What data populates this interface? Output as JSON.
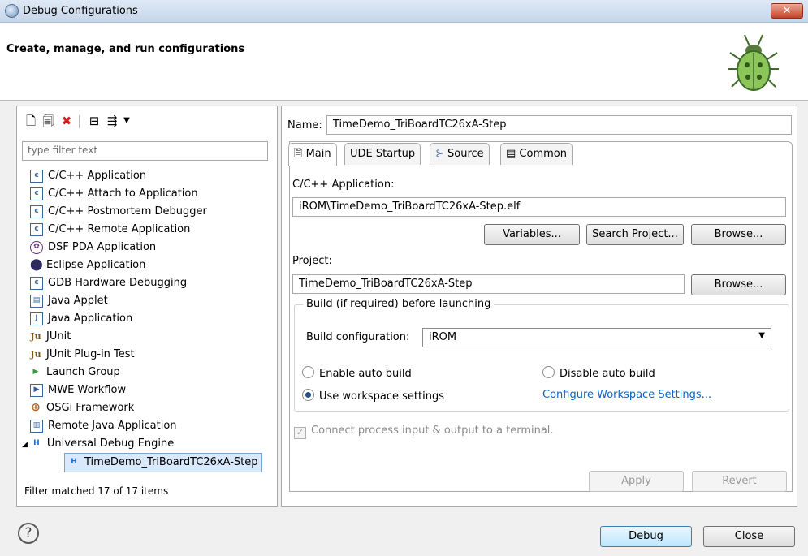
{
  "window": {
    "title": "Debug Configurations",
    "close_glyph": "✕"
  },
  "header": {
    "title": "Create, manage, and run configurations"
  },
  "left": {
    "filter_placeholder": "type filter text",
    "tree": [
      {
        "label": "C/C++ Application",
        "icon": "c-app-icon",
        "glyph": "c"
      },
      {
        "label": "C/C++ Attach to Application",
        "icon": "c-attach-icon",
        "glyph": "c"
      },
      {
        "label": "C/C++ Postmortem Debugger",
        "icon": "c-postmortem-icon",
        "glyph": "c"
      },
      {
        "label": "C/C++ Remote Application",
        "icon": "c-remote-icon",
        "glyph": "c"
      },
      {
        "label": "DSF PDA Application",
        "icon": "dsf-icon",
        "glyph": "✿"
      },
      {
        "label": "Eclipse Application",
        "icon": "eclipse-icon",
        "glyph": "⬤"
      },
      {
        "label": "GDB Hardware Debugging",
        "icon": "gdb-icon",
        "glyph": "c"
      },
      {
        "label": "Java Applet",
        "icon": "java-applet-icon",
        "glyph": "▤"
      },
      {
        "label": "Java Application",
        "icon": "java-app-icon",
        "glyph": "J"
      },
      {
        "label": "JUnit",
        "icon": "junit-icon",
        "glyph": "Ju"
      },
      {
        "label": "JUnit Plug-in Test",
        "icon": "junit-plugin-icon",
        "glyph": "Ju"
      },
      {
        "label": "Launch Group",
        "icon": "launch-group-icon",
        "glyph": "▶"
      },
      {
        "label": "MWE Workflow",
        "icon": "mwe-icon",
        "glyph": "▶"
      },
      {
        "label": "OSGi Framework",
        "icon": "osgi-icon",
        "glyph": "⊕"
      },
      {
        "label": "Remote Java Application",
        "icon": "remote-java-icon",
        "glyph": "▥"
      },
      {
        "label": "Universal Debug Engine",
        "icon": "ude-icon",
        "glyph": "H"
      },
      {
        "label": "TimeDemo_TriBoardTC26xA-Step",
        "icon": "ude-config-icon",
        "glyph": "H",
        "selected": true
      }
    ],
    "status": "Filter matched 17 of 17 items"
  },
  "right": {
    "name_label": "Name:",
    "name_value": "TimeDemo_TriBoardTC26xA-Step",
    "tabs": [
      "Main",
      "UDE Startup",
      "Source",
      "Common"
    ],
    "app_label": "C/C++ Application:",
    "app_value": "iROM\\TimeDemo_TriBoardTC26xA-Step.elf",
    "variables_btn": "Variables...",
    "search_btn": "Search Project...",
    "browse_btn": "Browse...",
    "project_label": "Project:",
    "project_value": "TimeDemo_TriBoardTC26xA-Step",
    "browse2_btn": "Browse...",
    "build_group": "Build (if required) before launching",
    "build_config_label": "Build configuration:",
    "build_config_value": "iROM",
    "enable_auto": "Enable auto build",
    "disable_auto": "Disable auto build",
    "use_workspace": "Use workspace settings",
    "configure_link": "Configure Workspace Settings...",
    "connect_terminal": "Connect process input & output to a terminal.",
    "apply_btn": "Apply",
    "revert_btn": "Revert"
  },
  "footer": {
    "help": "?",
    "debug_btn": "Debug",
    "close_btn": "Close"
  }
}
